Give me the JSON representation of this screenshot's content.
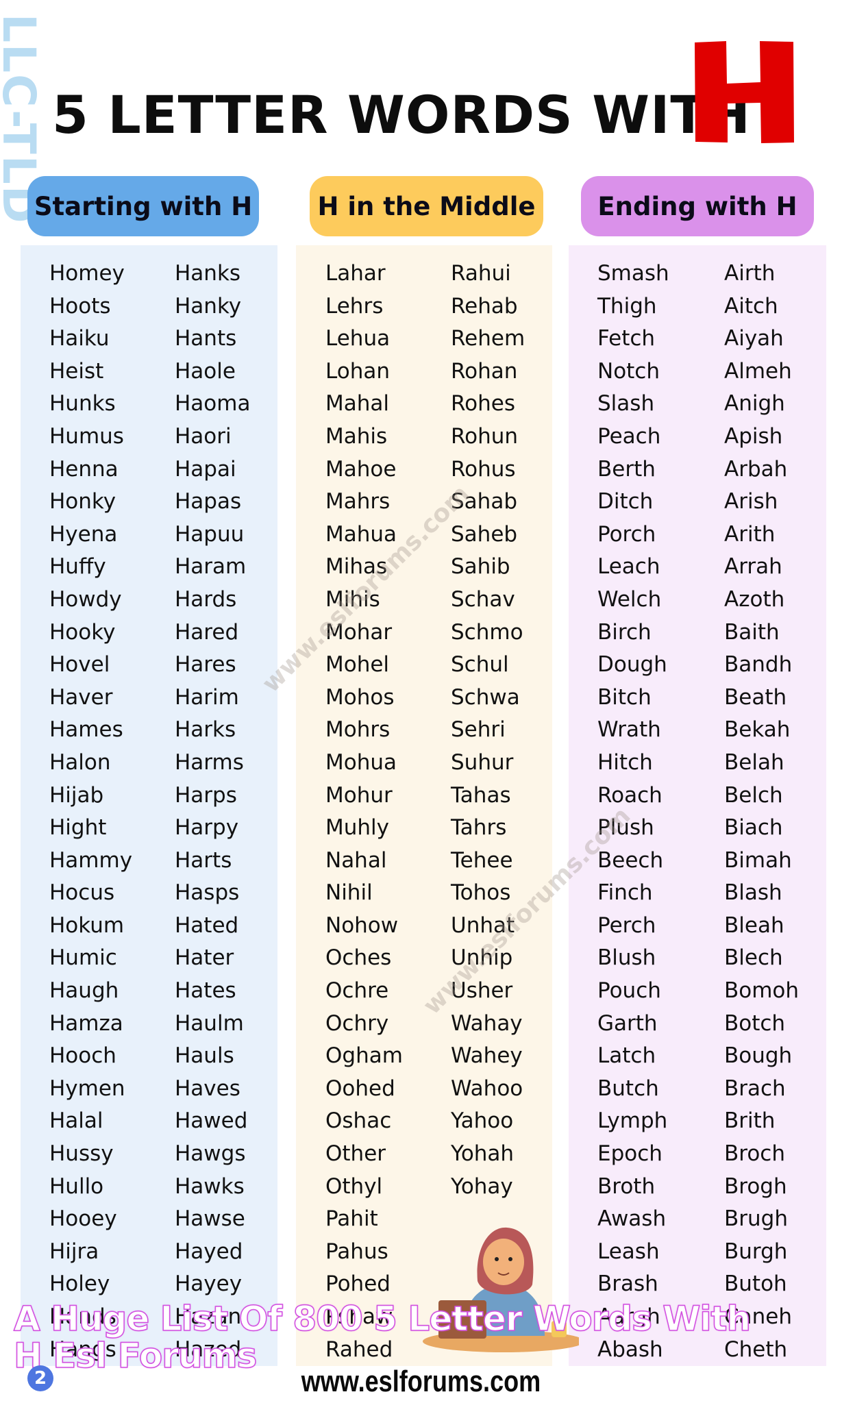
{
  "side_mark": "LLC-TLD",
  "title": "5 LETTER WORDS WITH",
  "title_letter": "H",
  "colors": {
    "title_letter": "#e00000",
    "pill_start": "#65a9e8",
    "pill_middle": "#fdcb5c",
    "pill_end": "#da91ea",
    "panel_start": "#e8f1fb",
    "panel_middle": "#fdf6e8",
    "panel_end": "#f8ecfb",
    "caption_stroke": "#d24fe0",
    "badge": "#4e76e0"
  },
  "sections": {
    "start": {
      "label": "Starting with H",
      "col1": [
        "Homey",
        "Hoots",
        "Haiku",
        "Heist",
        "Hunks",
        "Humus",
        "Henna",
        "Honky",
        "Hyena",
        "Huffy",
        "Howdy",
        "Hooky",
        "Hovel",
        "Haver",
        "Hames",
        "Halon",
        "Hijab",
        "Hight",
        "Hammy",
        "Hocus",
        "Hokum",
        "Humic",
        "Haugh",
        "Hamza",
        "Hooch",
        "Hymen",
        "Halal",
        "Hussy",
        "Hullo",
        "Hooey",
        "Hijra",
        "Holey",
        "Hands",
        "Hangs"
      ],
      "col2": [
        "Hanks",
        "Hanky",
        "Hants",
        "Haole",
        "Haoma",
        "Haori",
        "Hapai",
        "Hapas",
        "Hapuu",
        "Haram",
        "Hards",
        "Hared",
        "Hares",
        "Harim",
        "Harks",
        "Harms",
        "Harps",
        "Harpy",
        "Harts",
        "Hasps",
        "Hated",
        "Hater",
        "Hates",
        "Haulm",
        "Hauls",
        "Haves",
        "Hawed",
        "Hawgs",
        "Hawks",
        "Hawse",
        "Hayed",
        "Hayey",
        "Hazan",
        "Hazed"
      ]
    },
    "middle": {
      "label": "H in the Middle",
      "col1": [
        "Lahar",
        "Lehrs",
        "Lehua",
        "Lohan",
        "Mahal",
        "Mahis",
        "Mahoe",
        "Mahrs",
        "Mahua",
        "Mihas",
        "Mihis",
        "Mohar",
        "Mohel",
        "Mohos",
        "Mohrs",
        "Mohua",
        "Mohur",
        "Muhly",
        "Nahal",
        "Nihil",
        "Nohow",
        "Oches",
        "Ochre",
        "Ochry",
        "Ogham",
        "Oohed",
        "Oshac",
        "Other",
        "Othyl",
        "Pahit",
        "Pahus",
        "Pohed",
        "Pshaw",
        "Rahed"
      ],
      "col2": [
        "Rahui",
        "Rehab",
        "Rehem",
        "Rohan",
        "Rohes",
        "Rohun",
        "Rohus",
        "Sahab",
        "Saheb",
        "Sahib",
        "Schav",
        "Schmo",
        "Schul",
        "Schwa",
        "Sehri",
        "Suhur",
        "Tahas",
        "Tahrs",
        "Tehee",
        "Tohos",
        "Unhat",
        "Unhip",
        "Usher",
        "Wahay",
        "Wahey",
        "Wahoo",
        "Yahoo",
        "Yohah",
        "Yohay"
      ]
    },
    "end": {
      "label": "Ending with H",
      "col1": [
        "Smash",
        "Thigh",
        "Fetch",
        "Notch",
        "Slash",
        "Peach",
        "Berth",
        "Ditch",
        "Porch",
        "Leach",
        "Welch",
        "Birch",
        "Dough",
        "Bitch",
        "Wrath",
        "Hitch",
        "Roach",
        "Plush",
        "Beech",
        "Finch",
        "Perch",
        "Blush",
        "Pouch",
        "Garth",
        "Latch",
        "Butch",
        "Lymph",
        "Epoch",
        "Broth",
        "Awash",
        "Leash",
        "Brash",
        "Aargh",
        "Abash"
      ],
      "col2": [
        "Airth",
        "Aitch",
        "Aiyah",
        "Almeh",
        "Anigh",
        "Apish",
        "Arbah",
        "Arish",
        "Arith",
        "Arrah",
        "Azoth",
        "Baith",
        "Bandh",
        "Beath",
        "Bekah",
        "Belah",
        "Belch",
        "Biach",
        "Bimah",
        "Blash",
        "Bleah",
        "Blech",
        "Bomoh",
        "Botch",
        "Bough",
        "Brach",
        "Brith",
        "Broch",
        "Brogh",
        "Brugh",
        "Burgh",
        "Butoh",
        "Caneh",
        "Cheth"
      ]
    }
  },
  "watermark": "www.eslforums.com",
  "footer_url": "www.eslforums.com",
  "badge_count": "2",
  "caption": "A Huge List Of 800 5 Letter Words With H Esl Forums",
  "illustration": "woman-with-laptop-illustration"
}
